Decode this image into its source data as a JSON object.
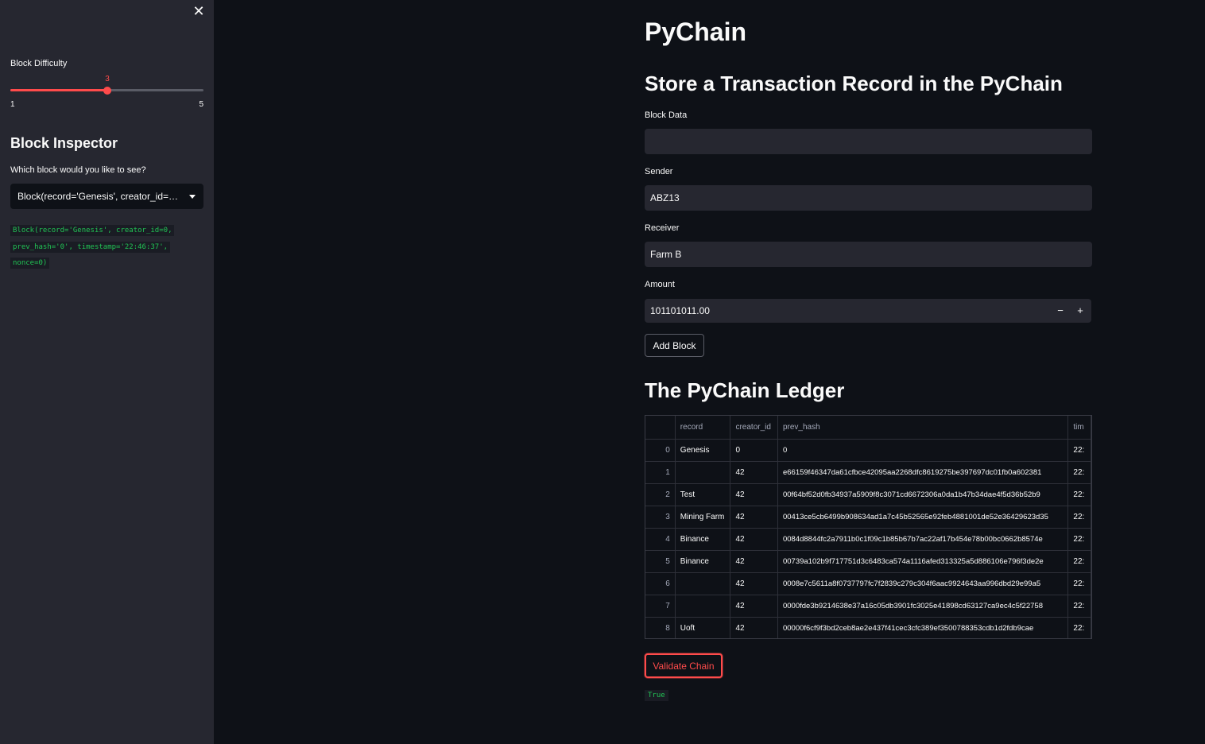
{
  "sidebar": {
    "close_icon": "close-icon",
    "difficulty_label": "Block Difficulty",
    "slider": {
      "value": "3",
      "min": "1",
      "max": "5",
      "fraction": 0.5
    },
    "inspector_heading": "Block Inspector",
    "select_label": "Which block would you like to see?",
    "select_value": "Block(record='Genesis', creator_id=0, prev_hash='0', timestamp='22:46:37', nonce=0)",
    "code_lines": [
      "Block(record='Genesis', creator_id=0,",
      "prev_hash='0', timestamp='22:46:37',",
      "nonce=0)"
    ]
  },
  "main": {
    "title": "PyChain",
    "form_heading": "Store a Transaction Record in the PyChain",
    "block_data_label": "Block Data",
    "block_data_value": "",
    "sender_label": "Sender",
    "sender_value": "ABZ13",
    "receiver_label": "Receiver",
    "receiver_value": "Farm B",
    "amount_label": "Amount",
    "amount_value": "101101011.00",
    "minus": "−",
    "plus": "+",
    "add_block_label": "Add Block",
    "ledger_heading": "The PyChain Ledger",
    "validate_label": "Validate Chain",
    "validate_result": "True"
  },
  "table": {
    "columns": [
      "",
      "record",
      "creator_id",
      "prev_hash",
      "tim"
    ],
    "rows": [
      [
        "0",
        "Genesis",
        "0",
        "0",
        "22:"
      ],
      [
        "1",
        "",
        "42",
        "e66159f46347da61cfbce42095aa2268dfc8619275be397697dc01fb0a602381",
        "22:"
      ],
      [
        "2",
        "Test",
        "42",
        "00f64bf52d0fb34937a5909f8c3071cd6672306a0da1b47b34dae4f5d36b52b9",
        "22:"
      ],
      [
        "3",
        "Mining Farm",
        "42",
        "00413ce5cb6499b908634ad1a7c45b52565e92feb4881001de52e36429623d35",
        "22:"
      ],
      [
        "4",
        "Binance",
        "42",
        "0084d8844fc2a7911b0c1f09c1b85b67b7ac22af17b454e78b00bc0662b8574e",
        "22:"
      ],
      [
        "5",
        "Binance",
        "42",
        "00739a102b9f717751d3c6483ca574a1116afed313325a5d886106e796f3de2e",
        "22:"
      ],
      [
        "6",
        "",
        "42",
        "0008e7c5611a8f0737797fc7f2839c279c304f6aac9924643aa996dbd29e99a5",
        "22:"
      ],
      [
        "7",
        "",
        "42",
        "0000fde3b9214638e37a16c05db3901fc3025e41898cd63127ca9ec4c5f22758",
        "22:"
      ],
      [
        "8",
        "Uoft",
        "42",
        "00000f6cf9f3bd2ceb8ae2e437f41cec3cfc389ef3500788353cdb1d2fdb9cae",
        "22:"
      ]
    ]
  }
}
